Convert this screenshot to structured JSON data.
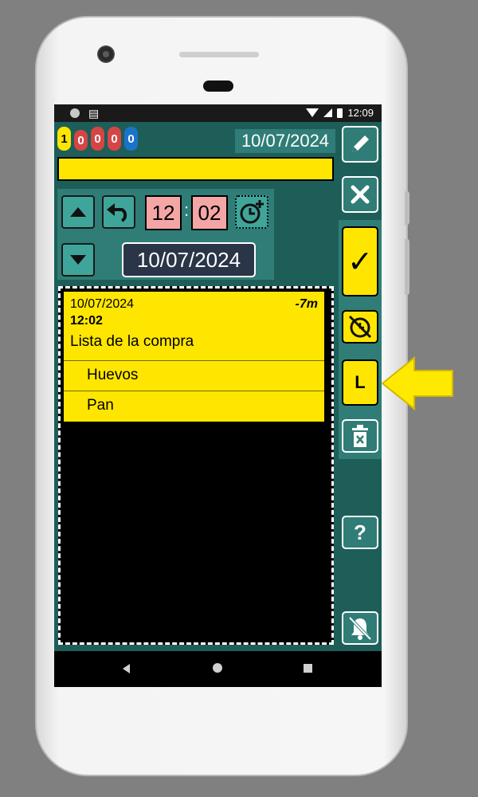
{
  "status_bar": {
    "time": "12:09",
    "calendar_icon": "calendar-icon"
  },
  "badges": [
    {
      "value": "1",
      "color": "#ffe600"
    },
    {
      "value": "0",
      "color": "#d64545"
    },
    {
      "value": "0",
      "color": "#d64545"
    },
    {
      "value": "0",
      "color": "#d64545"
    },
    {
      "value": "0",
      "color": "#1a73c9"
    }
  ],
  "header": {
    "date": "10/07/2024"
  },
  "time_picker": {
    "hour": "12",
    "separator": ":",
    "minute": "02",
    "date": "10/07/2024"
  },
  "note": {
    "date": "10/07/2024",
    "relative_time": "-7m",
    "time": "12:02",
    "title": "Lista de la compra",
    "items": [
      "Huevos",
      "Pan"
    ]
  },
  "right_toolbar": {
    "list_label": "L",
    "check_label": "✓",
    "help_label": "?",
    "icons": [
      "edit-icon",
      "close-icon",
      "check-icon",
      "alarm-off-icon",
      "list-icon",
      "delete-icon",
      "help-icon",
      "notifications-off-icon"
    ]
  },
  "colors": {
    "app_background": "#1e5e59",
    "panel": "#2f7d76",
    "accent_yellow": "#ffe600",
    "time_box": "#f4a6a6"
  }
}
